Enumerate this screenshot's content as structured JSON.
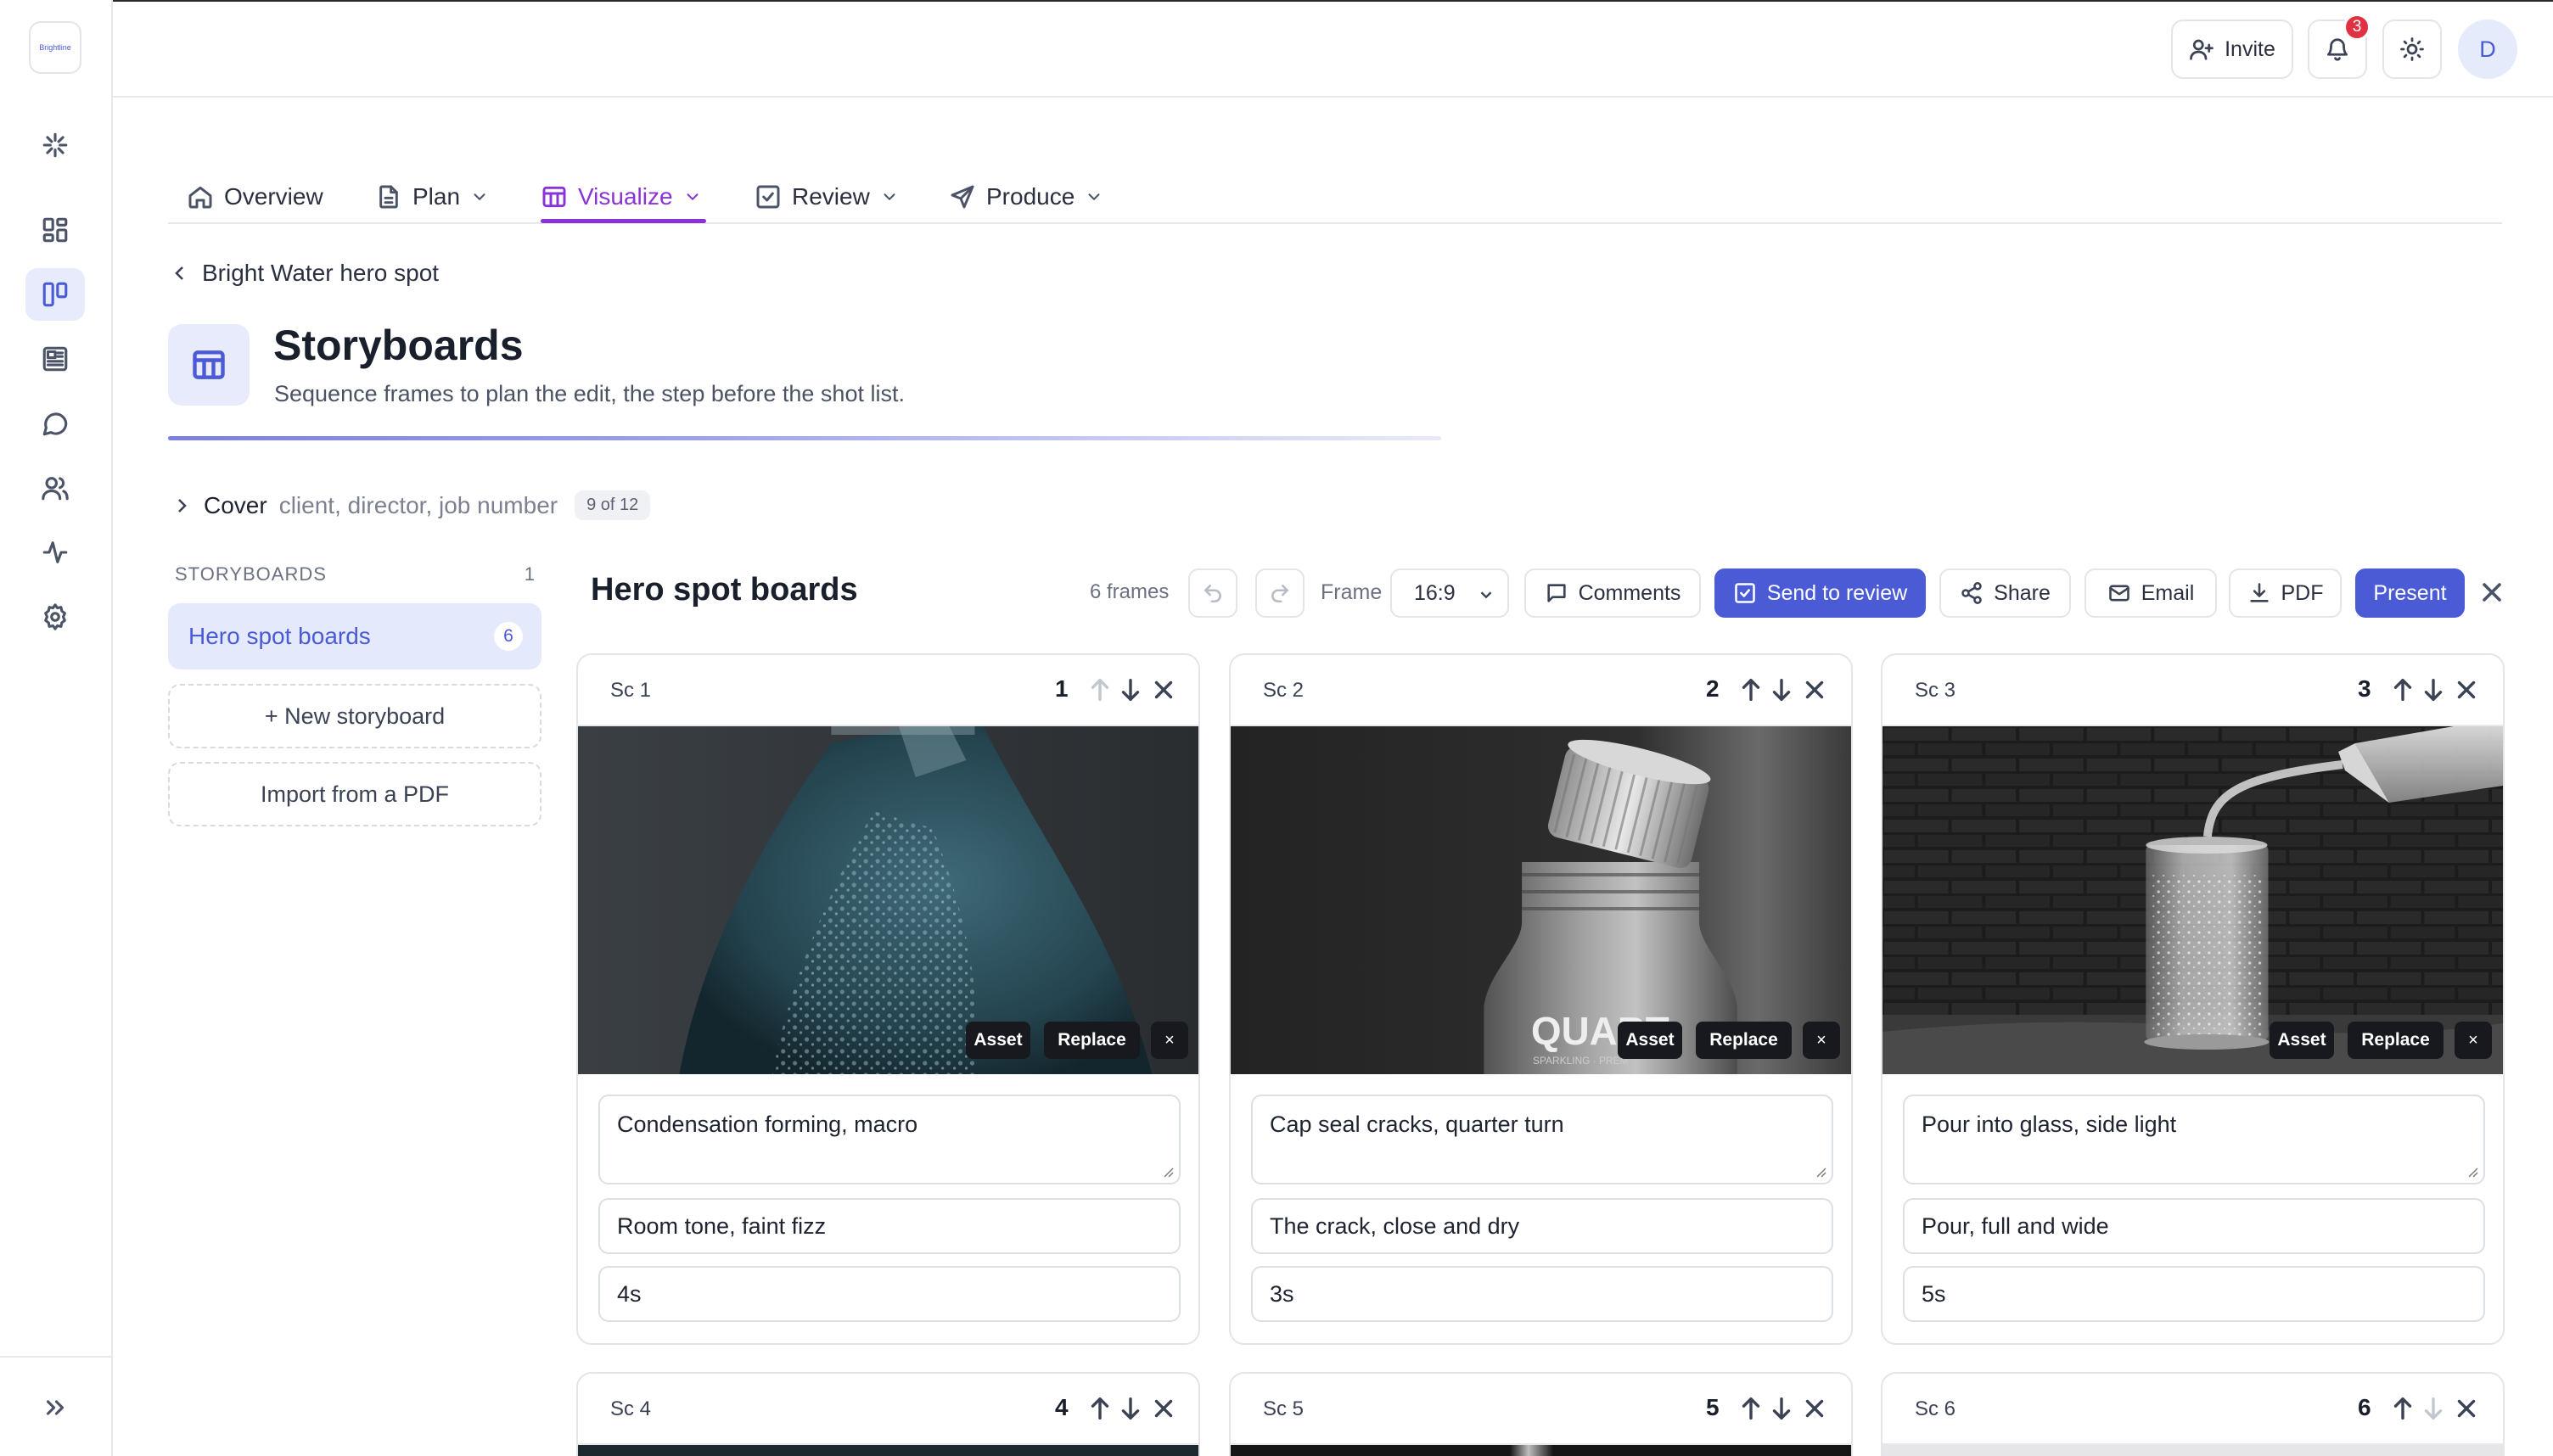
{
  "app": {
    "logo_text": "Brightline"
  },
  "header": {
    "invite_label": "Invite",
    "notification_count": "3",
    "avatar_initial": "D"
  },
  "tabs": [
    {
      "label": "Overview"
    },
    {
      "label": "Plan"
    },
    {
      "label": "Visualize"
    },
    {
      "label": "Review"
    },
    {
      "label": "Produce"
    }
  ],
  "breadcrumb": {
    "back_label": "Bright Water hero spot"
  },
  "page": {
    "title": "Storyboards",
    "subtitle": "Sequence frames to plan the edit, the step before the shot list."
  },
  "cover": {
    "label": "Cover",
    "hint": "client, director, job number",
    "progress": "9 of 12"
  },
  "sidebar": {
    "heading": "STORYBOARDS",
    "count": "1",
    "items": [
      {
        "label": "Hero spot boards",
        "count": "6"
      }
    ],
    "new_label": "+ New storyboard",
    "import_label": "Import from a PDF"
  },
  "board": {
    "title": "Hero spot boards",
    "frames_count": "6 frames",
    "frame_label": "Frame",
    "aspect": "16:9",
    "comments_label": "Comments",
    "send_label": "Send to review",
    "share_label": "Share",
    "email_label": "Email",
    "pdf_label": "PDF",
    "present_label": "Present"
  },
  "chips": {
    "asset": "Asset",
    "replace": "Replace",
    "remove": "×"
  },
  "frames": [
    {
      "scene": "Sc 1",
      "number": "1",
      "description": "Condensation forming, macro",
      "audio": "Room tone, faint fizz",
      "duration": "4s"
    },
    {
      "scene": "Sc 2",
      "number": "2",
      "description": "Cap seal cracks, quarter turn",
      "audio": "The crack, close and dry",
      "duration": "3s",
      "bottle_text": "QUART",
      "bottle_subtext": "SPARKLING · PREM"
    },
    {
      "scene": "Sc 3",
      "number": "3",
      "description": "Pour into glass, side light",
      "audio": "Pour, full and wide",
      "duration": "5s"
    },
    {
      "scene": "Sc 4",
      "number": "4"
    },
    {
      "scene": "Sc 5",
      "number": "5"
    },
    {
      "scene": "Sc 6",
      "number": "6"
    }
  ],
  "colors": {
    "accent": "#4b5bd6",
    "tab_active": "#8a33d6",
    "badge": "#e03243"
  }
}
